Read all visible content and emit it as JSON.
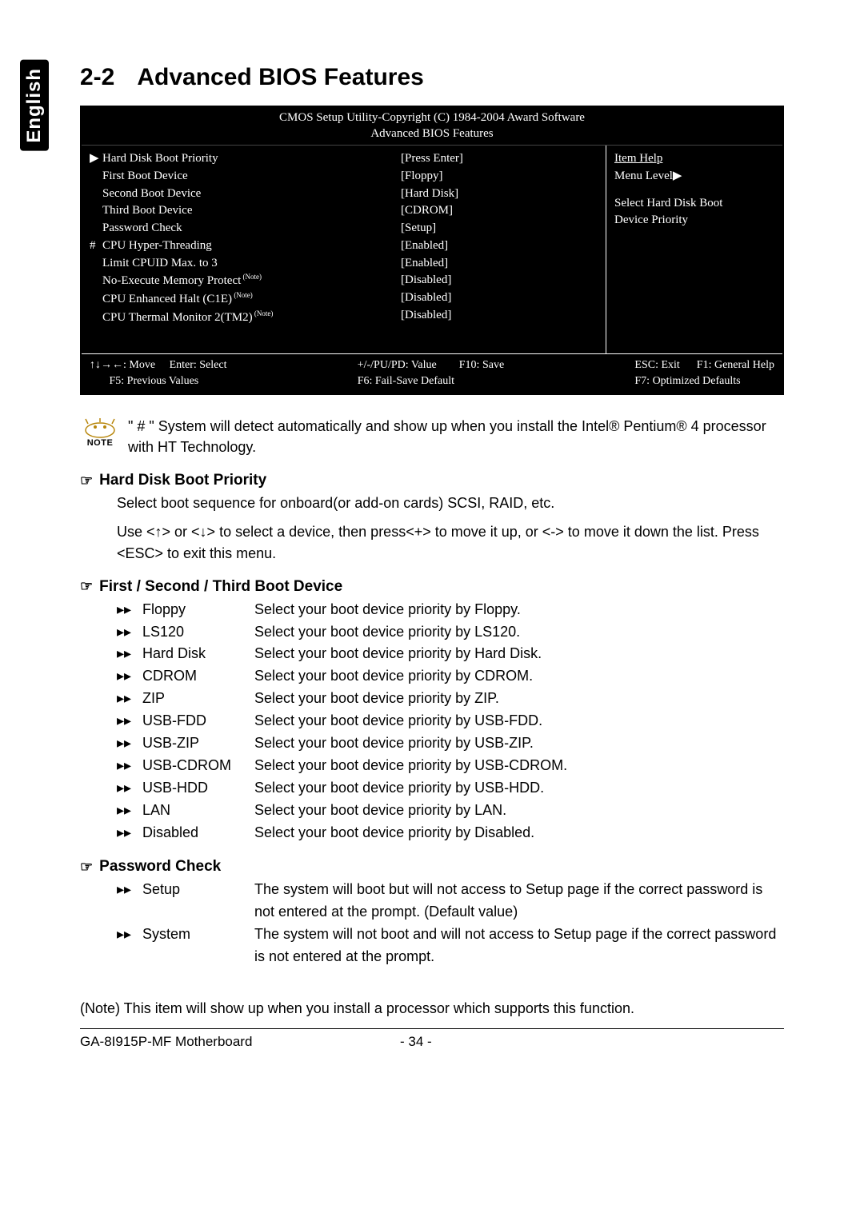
{
  "side_tab": "English",
  "section": {
    "num": "2-2",
    "title": "Advanced BIOS Features"
  },
  "bios": {
    "head1": "CMOS Setup Utility-Copyright (C) 1984-2004 Award Software",
    "head2": "Advanced BIOS Features",
    "items": [
      {
        "sym": "▶",
        "name": "Hard Disk Boot Priority",
        "val": "[Press Enter]"
      },
      {
        "sym": "",
        "name": "First Boot Device",
        "val": "[Floppy]"
      },
      {
        "sym": "",
        "name": "Second Boot Device",
        "val": "[Hard Disk]"
      },
      {
        "sym": "",
        "name": "Third Boot Device",
        "val": "[CDROM]"
      },
      {
        "sym": "",
        "name": "Password Check",
        "val": "[Setup]"
      },
      {
        "sym": "#",
        "name": "CPU Hyper-Threading",
        "val": "[Enabled]"
      },
      {
        "sym": "",
        "name": "Limit CPUID Max. to 3",
        "val": "[Enabled]"
      },
      {
        "sym": "",
        "name": "No-Execute Memory Protect",
        "sup": "(Note)",
        "val": "[Disabled]"
      },
      {
        "sym": "",
        "name": "CPU Enhanced Halt (C1E)",
        "sup": "(Note)",
        "val": "[Disabled]"
      },
      {
        "sym": "",
        "name": "CPU Thermal Monitor 2(TM2)",
        "sup": "(Note)",
        "val": "[Disabled]"
      }
    ],
    "help": {
      "label": "Item Help",
      "menu": "Menu Level▶",
      "desc1": "Select Hard Disk Boot",
      "desc2": "Device Priority"
    },
    "foot": {
      "c1a": "↑↓→←: Move",
      "c1b": "Enter: Select",
      "c2a": "+/-/PU/PD: Value",
      "c2b": "F10: Save",
      "c3a": "ESC: Exit",
      "c3b": "F1: General Help",
      "r2a": "F5: Previous Values",
      "r2b": "F6: Fail-Save Default",
      "r2c": "F7: Optimized Defaults"
    }
  },
  "note": "\" # \" System will detect automatically and show up when you install the Intel® Pentium® 4 processor with HT Technology.",
  "s_hdbp": {
    "title": "Hard Disk Boot Priority",
    "p1": "Select boot sequence for onboard(or add-on cards) SCSI, RAID, etc.",
    "p2": "Use <↑> or <↓> to select a device, then press<+> to move it up, or <-> to move it down the list. Press <ESC> to exit this menu."
  },
  "s_boot": {
    "title": "First / Second / Third Boot Device",
    "opts": [
      {
        "label": "Floppy",
        "text": "Select your boot device priority by Floppy."
      },
      {
        "label": "LS120",
        "text": "Select your boot device priority by LS120."
      },
      {
        "label": "Hard Disk",
        "text": "Select your boot device priority by Hard Disk."
      },
      {
        "label": "CDROM",
        "text": "Select your boot device priority by CDROM."
      },
      {
        "label": "ZIP",
        "text": "Select your boot device priority by ZIP."
      },
      {
        "label": "USB-FDD",
        "text": "Select your boot device priority by USB-FDD."
      },
      {
        "label": "USB-ZIP",
        "text": "Select your boot device priority by USB-ZIP."
      },
      {
        "label": "USB-CDROM",
        "text": "Select your boot device priority by USB-CDROM."
      },
      {
        "label": "USB-HDD",
        "text": "Select your boot device priority by USB-HDD."
      },
      {
        "label": "LAN",
        "text": "Select your boot device priority by LAN."
      },
      {
        "label": "Disabled",
        "text": "Select your boot device priority by Disabled."
      }
    ]
  },
  "s_pwd": {
    "title": "Password Check",
    "opts": [
      {
        "label": "Setup",
        "text": "The system will boot but will not access to Setup page if the correct password is not entered at the prompt. (Default value)"
      },
      {
        "label": "System",
        "text": "The system will not boot and will not access to Setup page if the correct password is not entered at the prompt."
      }
    ]
  },
  "footnote": "(Note)   This item will show up when you install a processor which supports this function.",
  "footer": {
    "left": "GA-8I915P-MF Motherboard",
    "center": "- 34 -"
  }
}
